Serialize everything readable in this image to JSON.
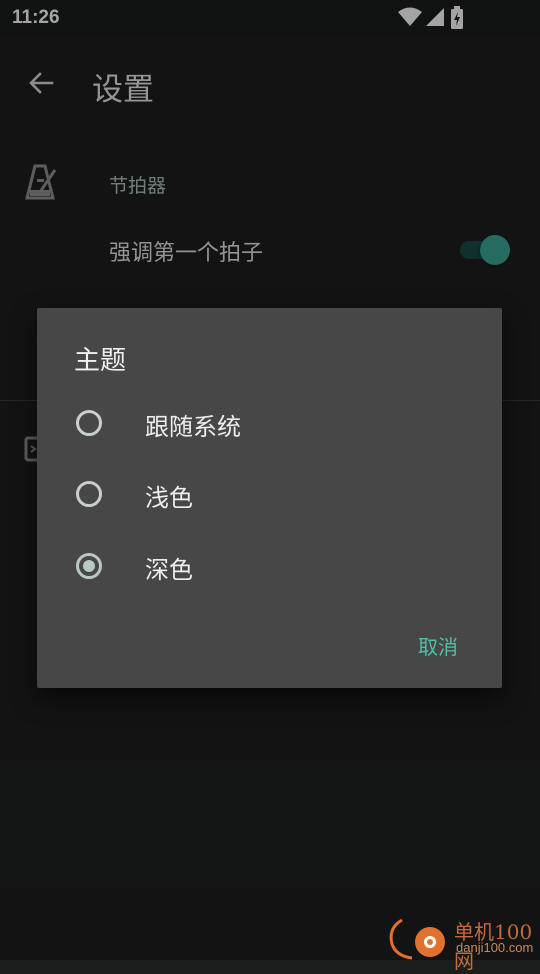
{
  "status_bar": {
    "time": "11:26",
    "icons": [
      "wifi-icon",
      "signal-icon",
      "battery-charging-icon"
    ]
  },
  "app_bar": {
    "back_icon": "arrow-back-icon",
    "title": "设置"
  },
  "settings": {
    "section": {
      "icon": "metronome-icon",
      "label": "节拍器"
    },
    "accent_first_beat": {
      "title": "强调第一个拍子",
      "enabled": true
    }
  },
  "dialog": {
    "title": "主题",
    "options": [
      {
        "label": "跟随系统",
        "selected": false
      },
      {
        "label": "浅色",
        "selected": false
      },
      {
        "label": "深色",
        "selected": true
      }
    ],
    "cancel_label": "取消"
  },
  "watermark": {
    "text": "单机100网",
    "url": "danji100.com"
  },
  "colors": {
    "accent": "#4dc1a8",
    "switch_thumb": "#3a9e8e",
    "dialog_bg": "#474747",
    "background": "#1c1d1d"
  }
}
